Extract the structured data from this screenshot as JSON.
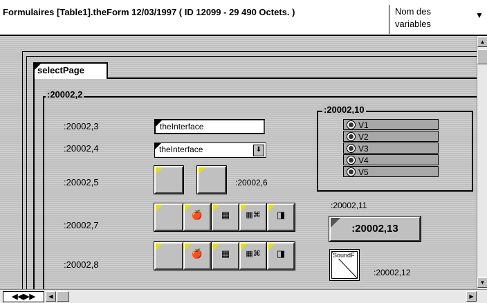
{
  "header": {
    "title": "Formulaires [Table1].theForm  12/03/1997 ( ID 12099 - 29 490 Octets. )",
    "variable_selector": "Nom des variables"
  },
  "tab": {
    "label": "selectPage"
  },
  "groups": {
    "outer": ":20002,2",
    "radio_group": ":20002,10"
  },
  "labels": {
    "l3": ":20002,3",
    "l4": ":20002,4",
    "l5": ":20002,5",
    "l6": ":20002,6",
    "l7": ":20002,7",
    "l8": ":20002,8",
    "l11": ":20002,11",
    "l12": ":20002,12"
  },
  "fields": {
    "text_field": "theInterface",
    "dropdown": "theInterface"
  },
  "button13": ":20002,13",
  "sound_label": "SoundF",
  "radios": [
    "V1",
    "V2",
    "V3",
    "V4",
    "V5"
  ],
  "scrollbar": {
    "nav_arrows": "◀◀▶▶"
  }
}
